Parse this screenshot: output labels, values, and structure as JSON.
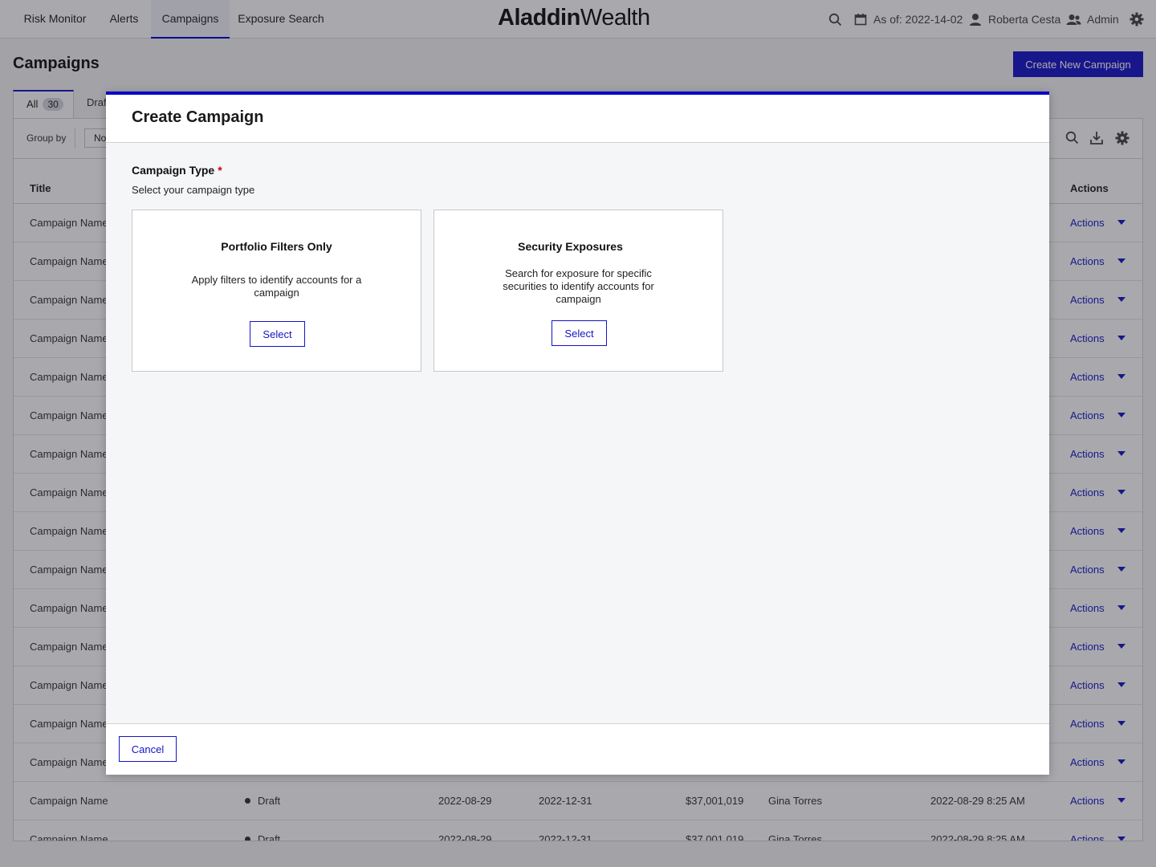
{
  "nav": {
    "tabs": [
      {
        "label": "Risk Monitor"
      },
      {
        "label": "Alerts"
      },
      {
        "label": "Campaigns"
      },
      {
        "label": "Exposure Search"
      }
    ],
    "logo": {
      "bold": "Aladdin",
      "light": "Wealth"
    },
    "as_of": "As of: 2022-14-02",
    "user": "Roberta Cesta",
    "role": "Admin"
  },
  "page": {
    "title": "Campaigns",
    "create_button": "Create New Campaign",
    "tabs": {
      "all_label": "All",
      "all_count": "30",
      "draft_label": "Draf"
    },
    "toolbar": {
      "group_by_label": "Group by",
      "group_by_value": "No"
    },
    "columns": {
      "title": "Title",
      "actions": "Actions"
    }
  },
  "table": {
    "rows": [
      {
        "title": "Campaign Name",
        "status": "",
        "start": "",
        "end": "",
        "amount": "",
        "owner": "",
        "modified": "",
        "actions": "Actions"
      },
      {
        "title": "Campaign Name",
        "status": "",
        "start": "",
        "end": "",
        "amount": "",
        "owner": "",
        "modified": "",
        "actions": "Actions"
      },
      {
        "title": "Campaign Name",
        "status": "",
        "start": "",
        "end": "",
        "amount": "",
        "owner": "",
        "modified": "",
        "actions": "Actions"
      },
      {
        "title": "Campaign Name",
        "status": "",
        "start": "",
        "end": "",
        "amount": "",
        "owner": "",
        "modified": "",
        "actions": "Actions"
      },
      {
        "title": "Campaign Name",
        "status": "",
        "start": "",
        "end": "",
        "amount": "",
        "owner": "",
        "modified": "",
        "actions": "Actions"
      },
      {
        "title": "Campaign Name",
        "status": "",
        "start": "",
        "end": "",
        "amount": "",
        "owner": "",
        "modified": "",
        "actions": "Actions"
      },
      {
        "title": "Campaign Name",
        "status": "",
        "start": "",
        "end": "",
        "amount": "",
        "owner": "",
        "modified": "",
        "actions": "Actions"
      },
      {
        "title": "Campaign Name",
        "status": "",
        "start": "",
        "end": "",
        "amount": "",
        "owner": "",
        "modified": "",
        "actions": "Actions"
      },
      {
        "title": "Campaign Name",
        "status": "",
        "start": "",
        "end": "",
        "amount": "",
        "owner": "",
        "modified": "",
        "actions": "Actions"
      },
      {
        "title": "Campaign Name",
        "status": "",
        "start": "",
        "end": "",
        "amount": "",
        "owner": "",
        "modified": "",
        "actions": "Actions"
      },
      {
        "title": "Campaign Name",
        "status": "",
        "start": "",
        "end": "",
        "amount": "",
        "owner": "",
        "modified": "",
        "actions": "Actions"
      },
      {
        "title": "Campaign Name",
        "status": "",
        "start": "",
        "end": "",
        "amount": "",
        "owner": "",
        "modified": "",
        "actions": "Actions"
      },
      {
        "title": "Campaign Name",
        "status": "",
        "start": "",
        "end": "",
        "amount": "",
        "owner": "",
        "modified": "",
        "actions": "Actions"
      },
      {
        "title": "Campaign Name",
        "status": "",
        "start": "",
        "end": "",
        "amount": "",
        "owner": "",
        "modified": "",
        "actions": "Actions"
      },
      {
        "title": "Campaign Name",
        "status": "",
        "start": "",
        "end": "",
        "amount": "",
        "owner": "",
        "modified": "",
        "actions": "Actions"
      },
      {
        "title": "Campaign Name",
        "status": "Draft",
        "start": "2022-08-29",
        "end": "2022-12-31",
        "amount": "$37,001,019",
        "owner": "Gina Torres",
        "modified": "2022-08-29 8:25 AM",
        "actions": "Actions"
      },
      {
        "title": "Campaign Name",
        "status": "Draft",
        "start": "2022-08-29",
        "end": "2022-12-31",
        "amount": "$37,001,019",
        "owner": "Gina Torres",
        "modified": "2022-08-29 8:25 AM",
        "actions": "Actions"
      }
    ]
  },
  "modal": {
    "title": "Create Campaign",
    "field_label": "Campaign Type",
    "required_marker": "*",
    "field_help": "Select your campaign type",
    "cards": [
      {
        "title": "Portfolio Filters Only",
        "description": "Apply filters to identify accounts for a campaign",
        "button": "Select"
      },
      {
        "title": "Security Exposures",
        "description": "Search for exposure for specific securities to identify accounts for campaign",
        "button": "Select"
      }
    ],
    "cancel_button": "Cancel"
  },
  "colors": {
    "accent": "#1414c8",
    "modal_top_border": "#0000c8",
    "required": "#d00000"
  },
  "icons": [
    "search-icon",
    "calendar-icon",
    "user-icon",
    "admin-users-icon",
    "gear-icon",
    "download-icon",
    "caret-down-icon"
  ]
}
